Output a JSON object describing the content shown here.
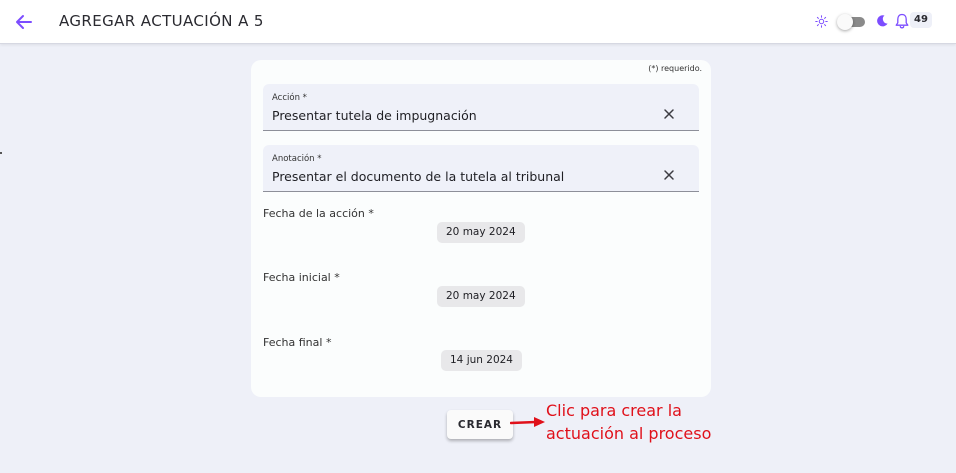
{
  "header": {
    "title": "AGREGAR ACTUACIÓN A 5",
    "notification_count": "49"
  },
  "form": {
    "required_note": "(*) requerido.",
    "accion": {
      "label": "Acción *",
      "value": "Presentar tutela de impugnación"
    },
    "anotacion": {
      "label": "Anotación *",
      "value": "Presentar el documento de la tutela al tribunal"
    },
    "fecha_accion": {
      "label": "Fecha de la acción *",
      "value": "20 may 2024"
    },
    "fecha_inicial": {
      "label": "Fecha inicial *",
      "value": "20 may 2024"
    },
    "fecha_final": {
      "label": "Fecha final *",
      "value": "14 jun 2024"
    },
    "submit_label": "CREAR"
  },
  "annotation": {
    "line1": "Clic para crear la",
    "line2": "actuación al proceso"
  },
  "icons": {
    "back": "arrow-left-icon",
    "sun": "sun-icon",
    "moon": "moon-icon",
    "bell": "bell-icon",
    "clear": "close-icon"
  },
  "colors": {
    "accent": "#7c4dff",
    "annotation": "#e0101a",
    "background": "#eef0f8",
    "card": "#fbfdfd"
  },
  "theme_toggle": {
    "dark_mode": false
  }
}
